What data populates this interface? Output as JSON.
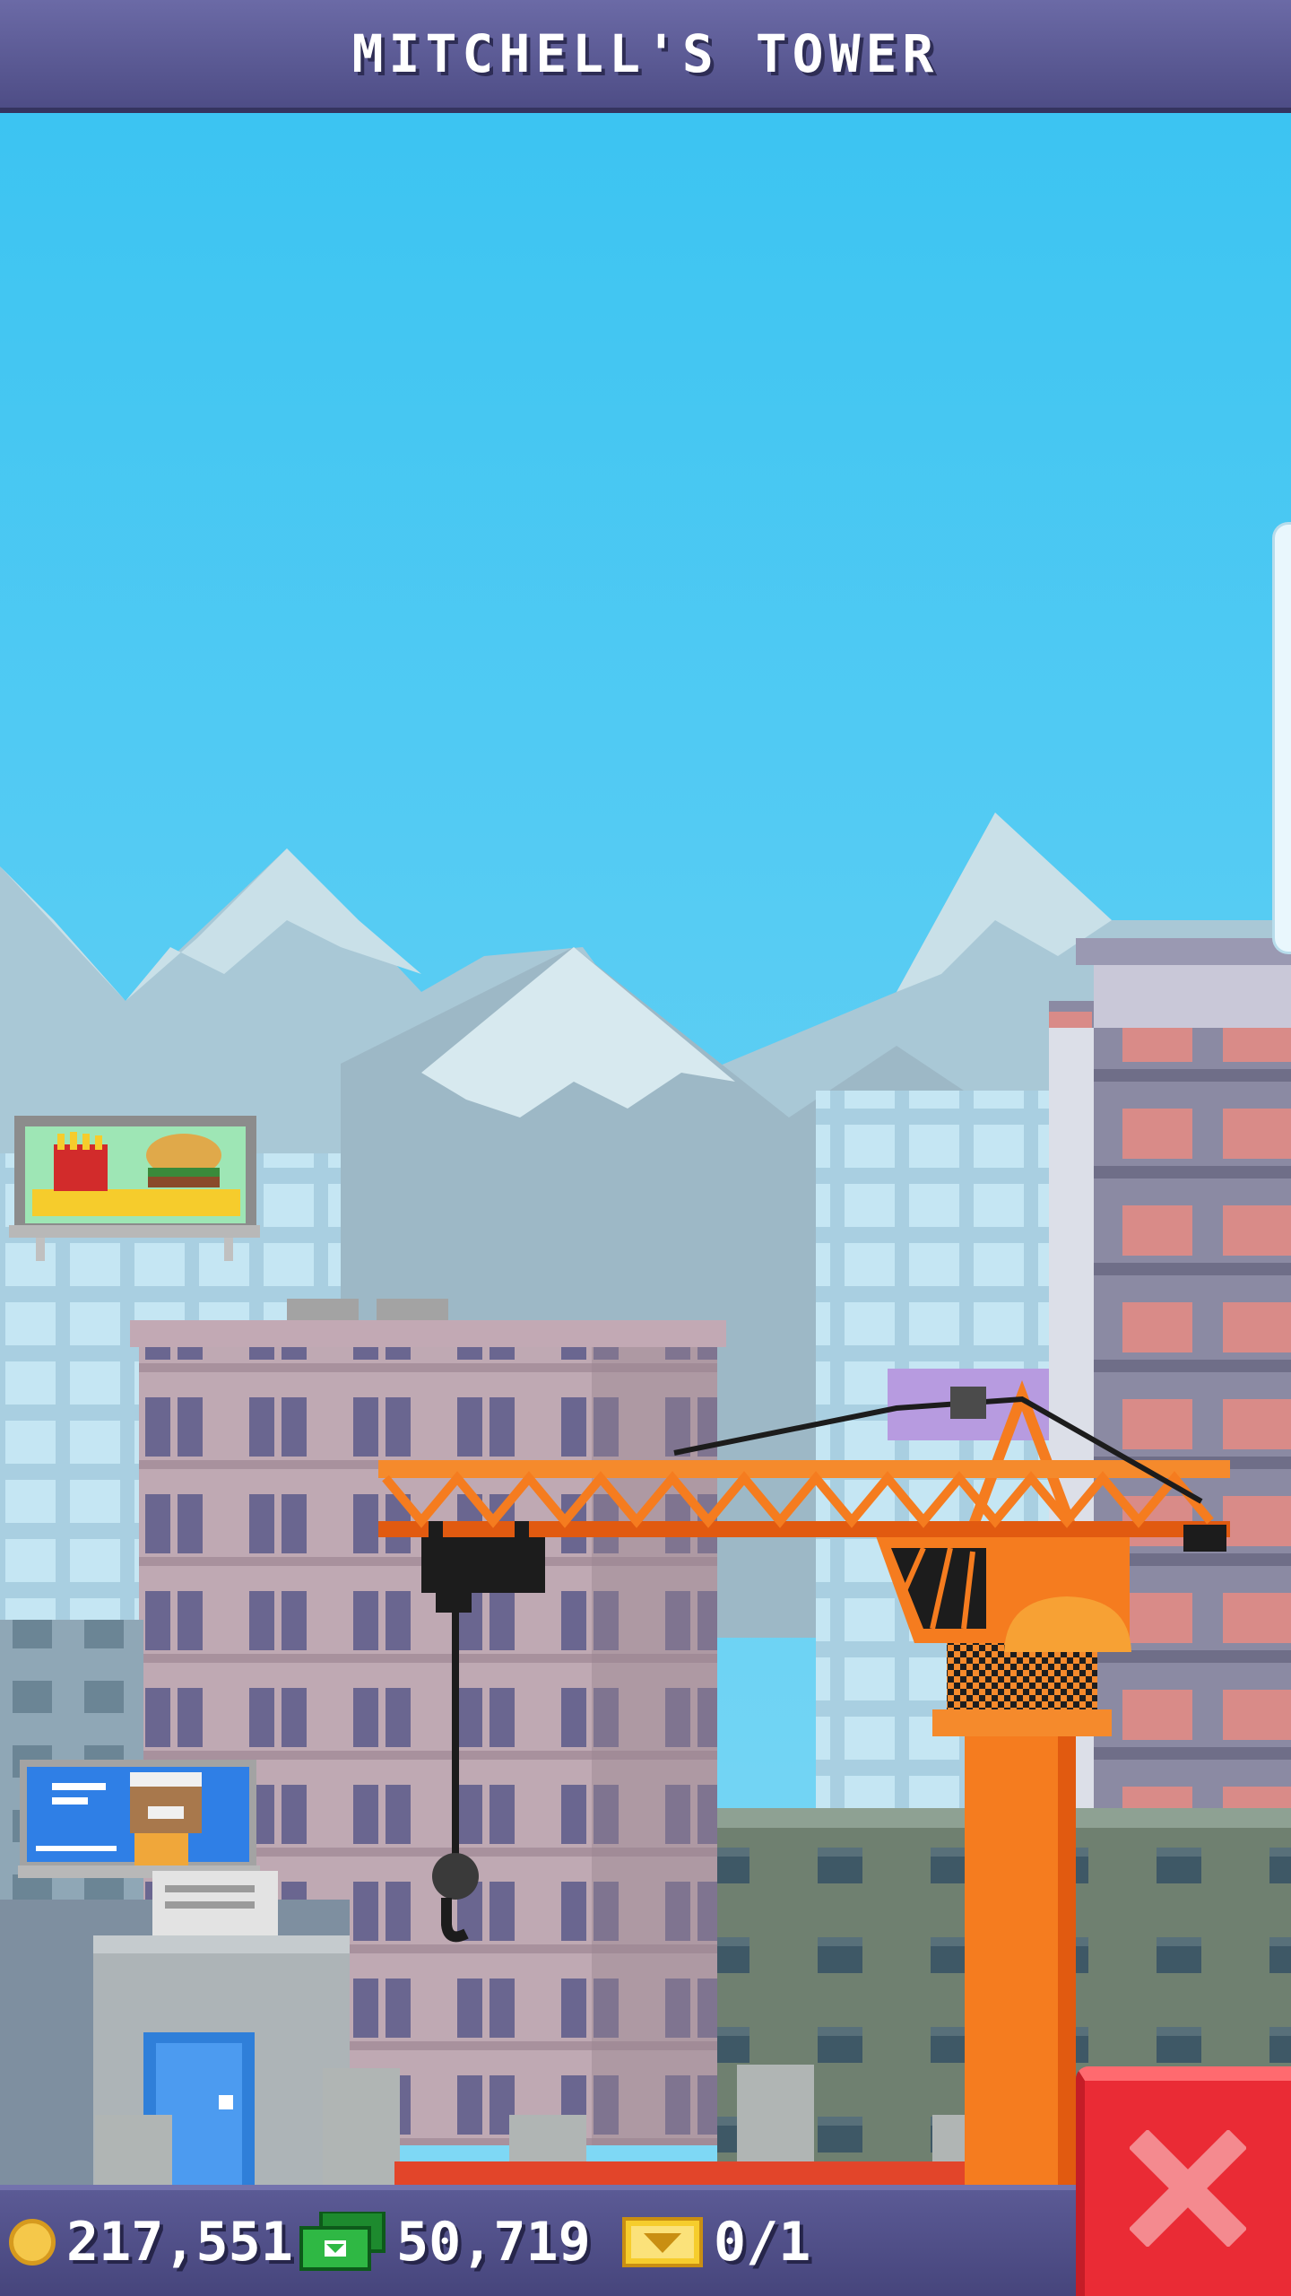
{
  "header": {
    "title": "MITCHELL'S TOWER"
  },
  "bottom_bar": {
    "coins": "217,551",
    "bux": "50,719",
    "vip": "0/1"
  },
  "icons": {
    "coins": "gold-coin-icon",
    "bux": "tower-bux-cash-icon",
    "vip": "vip-ticket-icon",
    "close": "close-x-icon"
  },
  "colors": {
    "sky": "#3ec6f2",
    "header": "#5c5b96",
    "crane": "#f57c1f",
    "close_button": "#ea2b35"
  }
}
